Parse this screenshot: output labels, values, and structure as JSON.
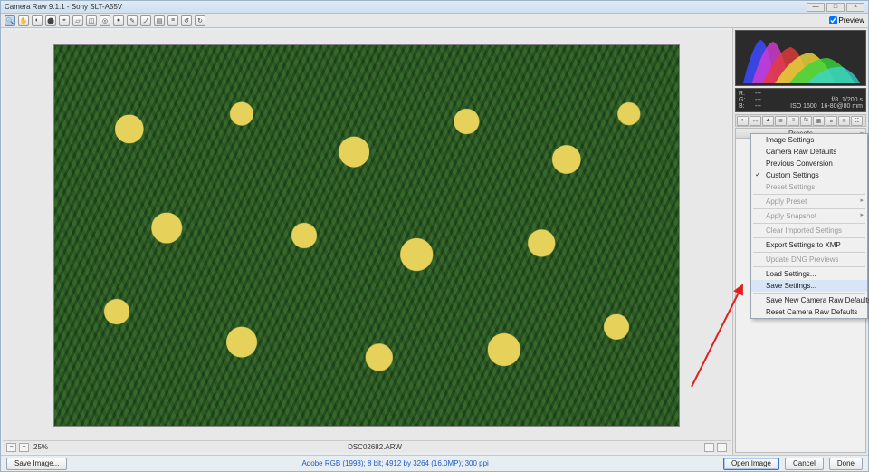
{
  "title": "Camera Raw 9.1.1  -  Sony SLT-A55V",
  "toolbar": {
    "preview_label": "Preview"
  },
  "exif": {
    "r_label": "R:",
    "g_label": "G:",
    "b_label": "B:",
    "r_val": "---",
    "g_val": "---",
    "b_val": "---",
    "aperture": "f/8",
    "shutter": "1/200 s",
    "iso": "ISO 1600",
    "lens": "16-80@80 mm"
  },
  "panel": {
    "header": "Presets",
    "menu_glyph": "≡"
  },
  "filmstrip": {
    "zoom": "25%",
    "filename": "DSC02682.ARW"
  },
  "footer": {
    "save_image": "Save Image...",
    "link": "Adobe RGB (1998); 8 bit; 4912 by 3264 (16.0MP); 300 ppi",
    "open_image": "Open Image",
    "cancel": "Cancel",
    "done": "Done"
  },
  "menu": {
    "image_settings": "Image Settings",
    "camera_raw_defaults": "Camera Raw Defaults",
    "previous_conversion": "Previous Conversion",
    "custom_settings": "Custom Settings",
    "preset_settings": "Preset Settings",
    "apply_preset": "Apply Preset",
    "apply_snapshot": "Apply Snapshot",
    "clear_imported": "Clear Imported Settings",
    "export_xmp": "Export Settings to XMP",
    "update_dng": "Update DNG Previews",
    "load_settings": "Load Settings...",
    "save_settings": "Save Settings...",
    "save_new_defaults": "Save New Camera Raw Defaults",
    "reset_defaults": "Reset Camera Raw Defaults"
  },
  "icons": {
    "zoom": "🔍",
    "hand": "✋",
    "wb": "◐",
    "color": "⬤",
    "target": "⌖",
    "crop": "▱",
    "straighten": "◫",
    "spot": "◎",
    "redeye": "●",
    "adjust": "✎",
    "brush": "ノ",
    "grad": "▤",
    "radial": "◯",
    "pref": "≡",
    "rot_l": "↺",
    "rot_r": "↻"
  },
  "tabs": [
    "◐",
    "〰",
    "▲",
    "≣",
    "≡",
    "fx",
    "▦",
    "⌀",
    "≋",
    "☷"
  ]
}
